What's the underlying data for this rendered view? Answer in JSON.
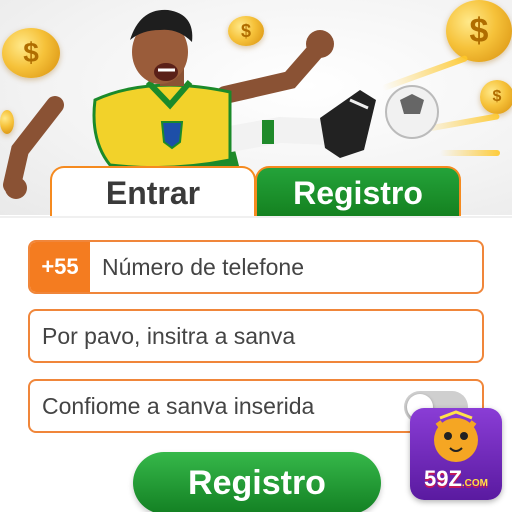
{
  "tabs": {
    "login_label": "Entrar",
    "register_label": "Registro"
  },
  "phone": {
    "prefix": "+55",
    "placeholder": "Número de telefone"
  },
  "password": {
    "placeholder": "Por pavo, insitra a sanva"
  },
  "confirm": {
    "placeholder": "Confiome a sanva inserida",
    "toggle_state": "off"
  },
  "submit_label": "Registro",
  "logo": {
    "main": "59Z",
    "suffix": ".COM"
  },
  "colors": {
    "accent_orange": "#f47c20",
    "brand_green": "#1a9a2e",
    "logo_purple": "#7a2fc8"
  },
  "icons": [
    "dollar-coin-icon",
    "soccer-ball-icon",
    "toggle-switch-icon"
  ]
}
